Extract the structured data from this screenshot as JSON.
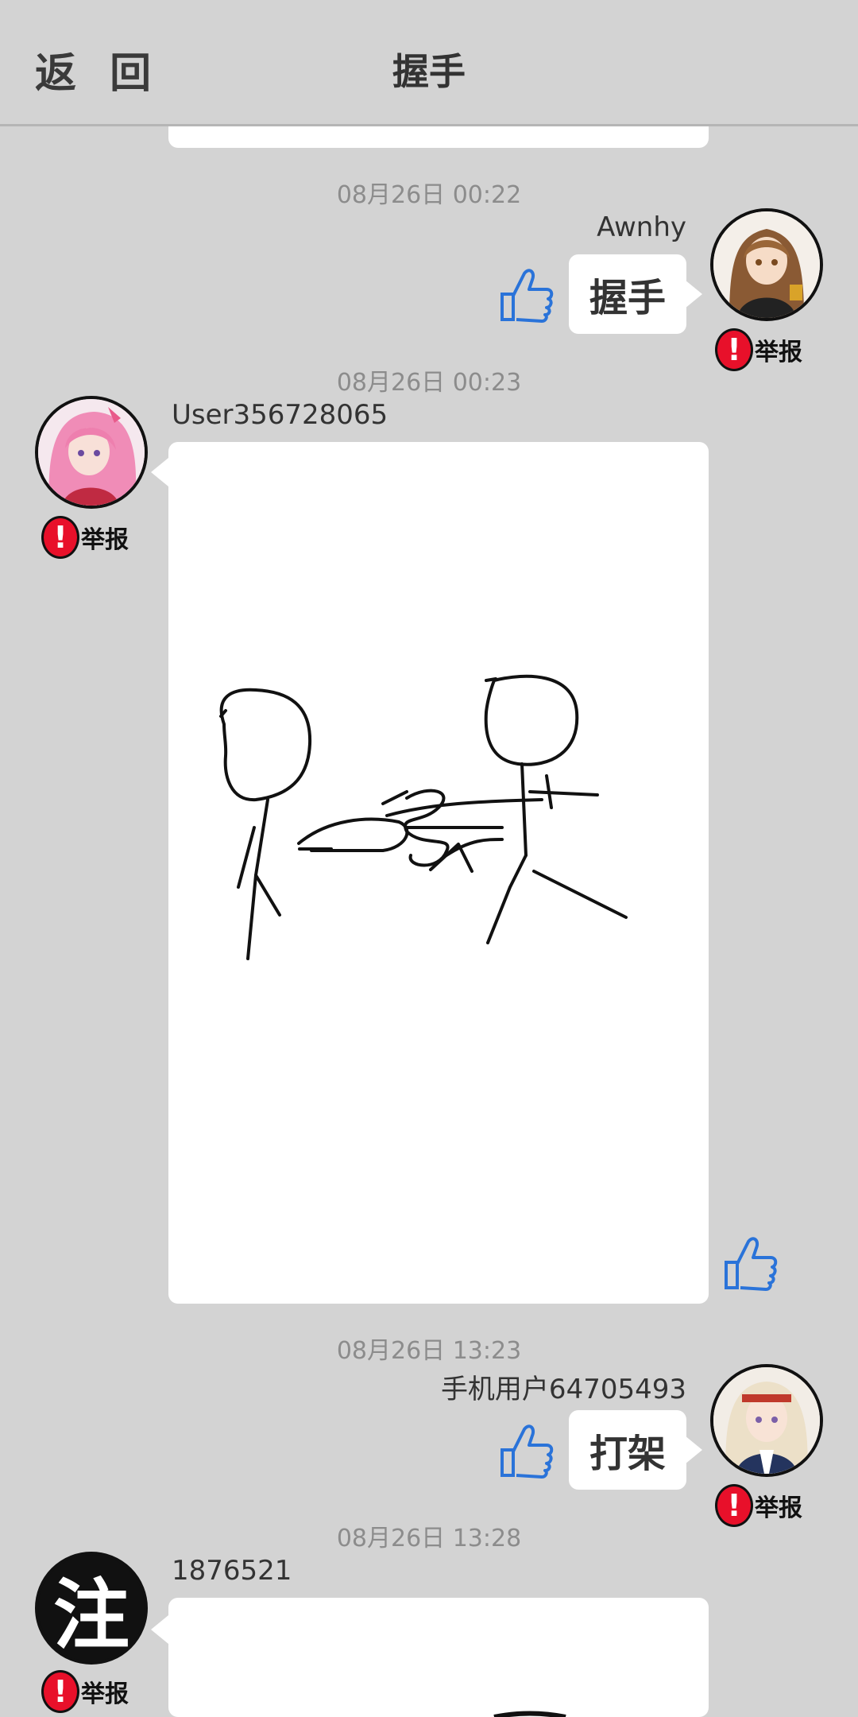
{
  "header": {
    "back_label": "返 回",
    "title": "握手"
  },
  "report_label": "举报",
  "messages": [
    {
      "time": "08月26日  00:22",
      "user": "Awnhy",
      "text": "握手",
      "side": "right"
    },
    {
      "time": "08月26日  00:23",
      "user": "User356728065",
      "type": "drawing",
      "side": "left"
    },
    {
      "time": "08月26日  13:23",
      "user": "手机用户64705493",
      "text": "打架",
      "side": "right"
    },
    {
      "time": "08月26日  13:28",
      "user": "1876521",
      "type": "drawing",
      "side": "left",
      "avatar_char": "注"
    }
  ],
  "colors": {
    "background": "#d3d3d3",
    "like_icon": "#2a73d9",
    "report_badge": "#e8102a"
  }
}
